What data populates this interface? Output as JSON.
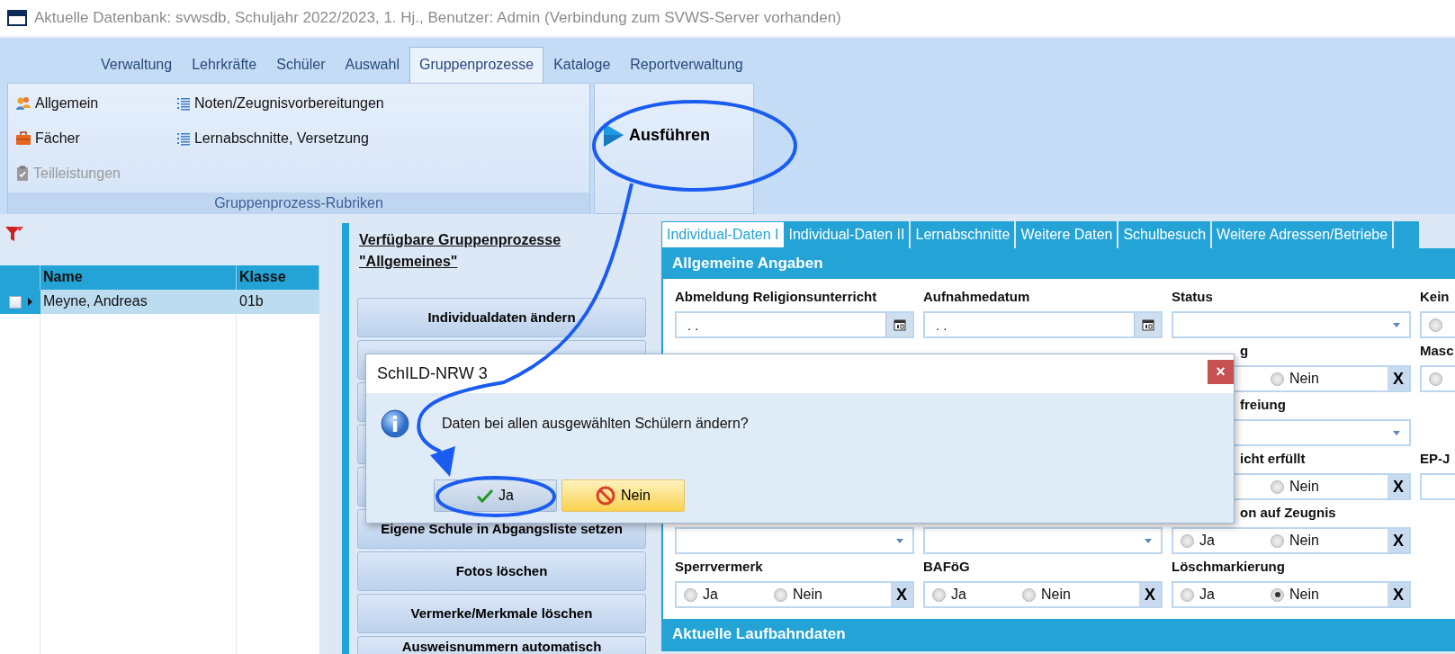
{
  "window": {
    "title": "Aktuelle Datenbank: svwsdb, Schuljahr 2022/2023, 1. Hj., Benutzer: Admin (Verbindung zum SVWS-Server vorhanden)"
  },
  "ribbon": {
    "tabs": [
      {
        "label": "Verwaltung",
        "selected": false
      },
      {
        "label": "Lehrkräfte",
        "selected": false
      },
      {
        "label": "Schüler",
        "selected": false
      },
      {
        "label": "Auswahl",
        "selected": false
      },
      {
        "label": "Gruppenprozesse",
        "selected": true
      },
      {
        "label": "Kataloge",
        "selected": false
      },
      {
        "label": "Reportverwaltung",
        "selected": false
      }
    ],
    "group": {
      "caption": "Gruppenprozess-Rubriken",
      "columns": [
        [
          {
            "label": "Allgemein",
            "disabled": false
          },
          {
            "label": "Fächer",
            "disabled": false
          },
          {
            "label": "Teilleistungen",
            "disabled": true
          }
        ],
        [
          {
            "label": "Noten/Zeugnisvorbereitungen",
            "disabled": false
          },
          {
            "label": "Lernabschnitte, Versetzung",
            "disabled": false
          }
        ]
      ]
    },
    "action": {
      "label": "Ausführen"
    }
  },
  "student_list": {
    "columns": [
      "Name",
      "Klasse"
    ],
    "rows": [
      {
        "name": "Meyne, Andreas",
        "klasse": "01b",
        "selected": true,
        "checked": false
      }
    ]
  },
  "processes": {
    "heading": "Verfügbare Gruppenprozesse \"Allgemeines\"",
    "buttons": [
      {
        "kind": "button",
        "label": "Individualdaten ändern"
      },
      {
        "kind": "covered"
      },
      {
        "kind": "covered"
      },
      {
        "kind": "covered"
      },
      {
        "kind": "covered"
      },
      {
        "kind": "button",
        "label": "Eigene Schule in Abgangsliste setzen"
      },
      {
        "kind": "button",
        "label": "Fotos löschen"
      },
      {
        "kind": "button",
        "label": "Vermerke/Merkmale löschen"
      },
      {
        "kind": "button",
        "label": "Ausweisnummern automatisch"
      }
    ]
  },
  "detail_tabs": [
    {
      "label": "Individual-Daten I",
      "selected": true
    },
    {
      "label": "Individual-Daten II",
      "selected": false
    },
    {
      "label": "Lernabschnitte",
      "selected": false
    },
    {
      "label": "Weitere Daten",
      "selected": false
    },
    {
      "label": "Schulbesuch",
      "selected": false
    },
    {
      "label": "Weitere Adressen/Betriebe",
      "selected": false
    }
  ],
  "sections": [
    {
      "title": "Allgemeine Angaben",
      "rows": [
        {
          "cells": [
            {
              "kind": "date",
              "label": "Abmeldung Religionsunterricht",
              "value": ". ."
            },
            {
              "kind": "date",
              "label": "Aufnahmedatum",
              "value": ". ."
            },
            {
              "kind": "dropdown",
              "label": "Status"
            },
            {
              "kind": "radio",
              "label": "Kein",
              "options": [
                {
                  "selected": false
                }
              ]
            }
          ]
        },
        {
          "cells": [
            {
              "kind": "blank"
            },
            {
              "kind": "blank"
            },
            {
              "kind": "radio",
              "label": "g",
              "label_covered": true,
              "options": [
                {
                  "label": "Nein",
                  "selected": false
                }
              ],
              "clear": "X"
            },
            {
              "kind": "radio",
              "label": "Masc",
              "options": [
                {
                  "selected": false
                }
              ]
            }
          ]
        },
        {
          "cells": [
            {
              "kind": "blank"
            },
            {
              "kind": "blank"
            },
            {
              "kind": "dropdown",
              "label": "freiung",
              "label_covered": true
            },
            {
              "kind": "blank"
            }
          ]
        },
        {
          "cells": [
            {
              "kind": "blank"
            },
            {
              "kind": "blank"
            },
            {
              "kind": "radio",
              "label": "icht erfüllt",
              "label_covered": true,
              "options": [
                {
                  "label": "Nein",
                  "selected": false
                }
              ],
              "clear": "X"
            },
            {
              "kind": "text",
              "label": "EP-J"
            }
          ]
        },
        {
          "cells": [
            {
              "kind": "dropdown"
            },
            {
              "kind": "dropdown"
            },
            {
              "kind": "radio",
              "label": "on auf Zeugnis",
              "label_covered": true,
              "options": [
                {
                  "label": "Ja",
                  "selected": false
                },
                {
                  "label": "Nein",
                  "selected": false
                }
              ],
              "clear": "X"
            },
            {
              "kind": "blank"
            }
          ]
        },
        {
          "cells": [
            {
              "kind": "radio",
              "label": "Sperrvermerk",
              "options": [
                {
                  "label": "Ja",
                  "selected": false
                },
                {
                  "label": "Nein",
                  "selected": false
                }
              ],
              "clear": "X"
            },
            {
              "kind": "radio",
              "label": "BAFöG",
              "options": [
                {
                  "label": "Ja",
                  "selected": false
                },
                {
                  "label": "Nein",
                  "selected": false
                }
              ],
              "clear": "X"
            },
            {
              "kind": "radio",
              "label": "Löschmarkierung",
              "options": [
                {
                  "label": "Ja",
                  "selected": false
                },
                {
                  "label": "Nein",
                  "selected": true
                }
              ],
              "clear": "X"
            },
            {
              "kind": "blank"
            }
          ]
        }
      ]
    },
    {
      "title": "Aktuelle Laufbahndaten"
    }
  ],
  "dialog": {
    "title": "SchILD-NRW 3",
    "close": "×",
    "message": "Daten bei allen ausgewählten Schülern ändern?",
    "buttons": [
      {
        "kind": "ok",
        "label": "Ja"
      },
      {
        "kind": "cancel",
        "label": "Nein"
      }
    ]
  }
}
